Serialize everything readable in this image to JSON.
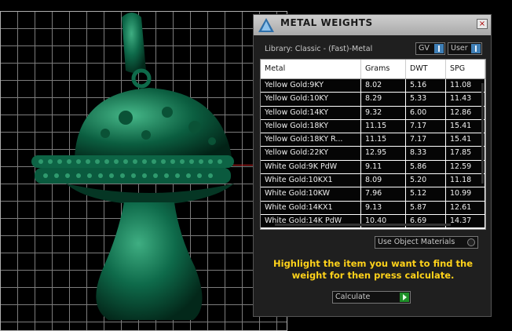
{
  "window": {
    "title": "METAL WEIGHTS",
    "close_glyph": "×"
  },
  "library": {
    "label": "Library: Classic - (Fast)-Metal"
  },
  "filters": [
    {
      "label": "GV"
    },
    {
      "label": "User"
    }
  ],
  "table": {
    "headers": [
      "Metal",
      "Grams",
      "DWT",
      "SPG"
    ],
    "rows": [
      [
        "Yellow Gold:9KY",
        "8.02",
        "5.16",
        "11.08"
      ],
      [
        "Yellow Gold:10KY",
        "8.29",
        "5.33",
        "11.43"
      ],
      [
        "Yellow Gold:14KY",
        "9.32",
        "6.00",
        "12.86"
      ],
      [
        "Yellow Gold:18KY",
        "11.15",
        "7.17",
        "15.41"
      ],
      [
        "Yellow Gold:18KY R...",
        "11.15",
        "7.17",
        "15.41"
      ],
      [
        "Yellow Gold:22KY",
        "12.95",
        "8.33",
        "17.85"
      ],
      [
        "White Gold:9K PdW",
        "9.11",
        "5.86",
        "12.59"
      ],
      [
        "White Gold:10KX1",
        "8.09",
        "5.20",
        "11.18"
      ],
      [
        "White Gold:10KW",
        "7.96",
        "5.12",
        "10.99"
      ],
      [
        "White Gold:14KX1",
        "9.13",
        "5.87",
        "12.61"
      ],
      [
        "White Gold:14K PdW",
        "10.40",
        "6.69",
        "14.37"
      ]
    ]
  },
  "options": {
    "use_object_materials": "Use Object Materials"
  },
  "hint": "Highlight the item you want to find the weight for then press calculate.",
  "actions": {
    "calculate_label": "Calculate"
  },
  "colors": {
    "accent_blue": "#3f7fb6",
    "go_green": "#1e8f28",
    "hint_yellow": "#ffd21a",
    "model_green": "#0e6a4a"
  }
}
